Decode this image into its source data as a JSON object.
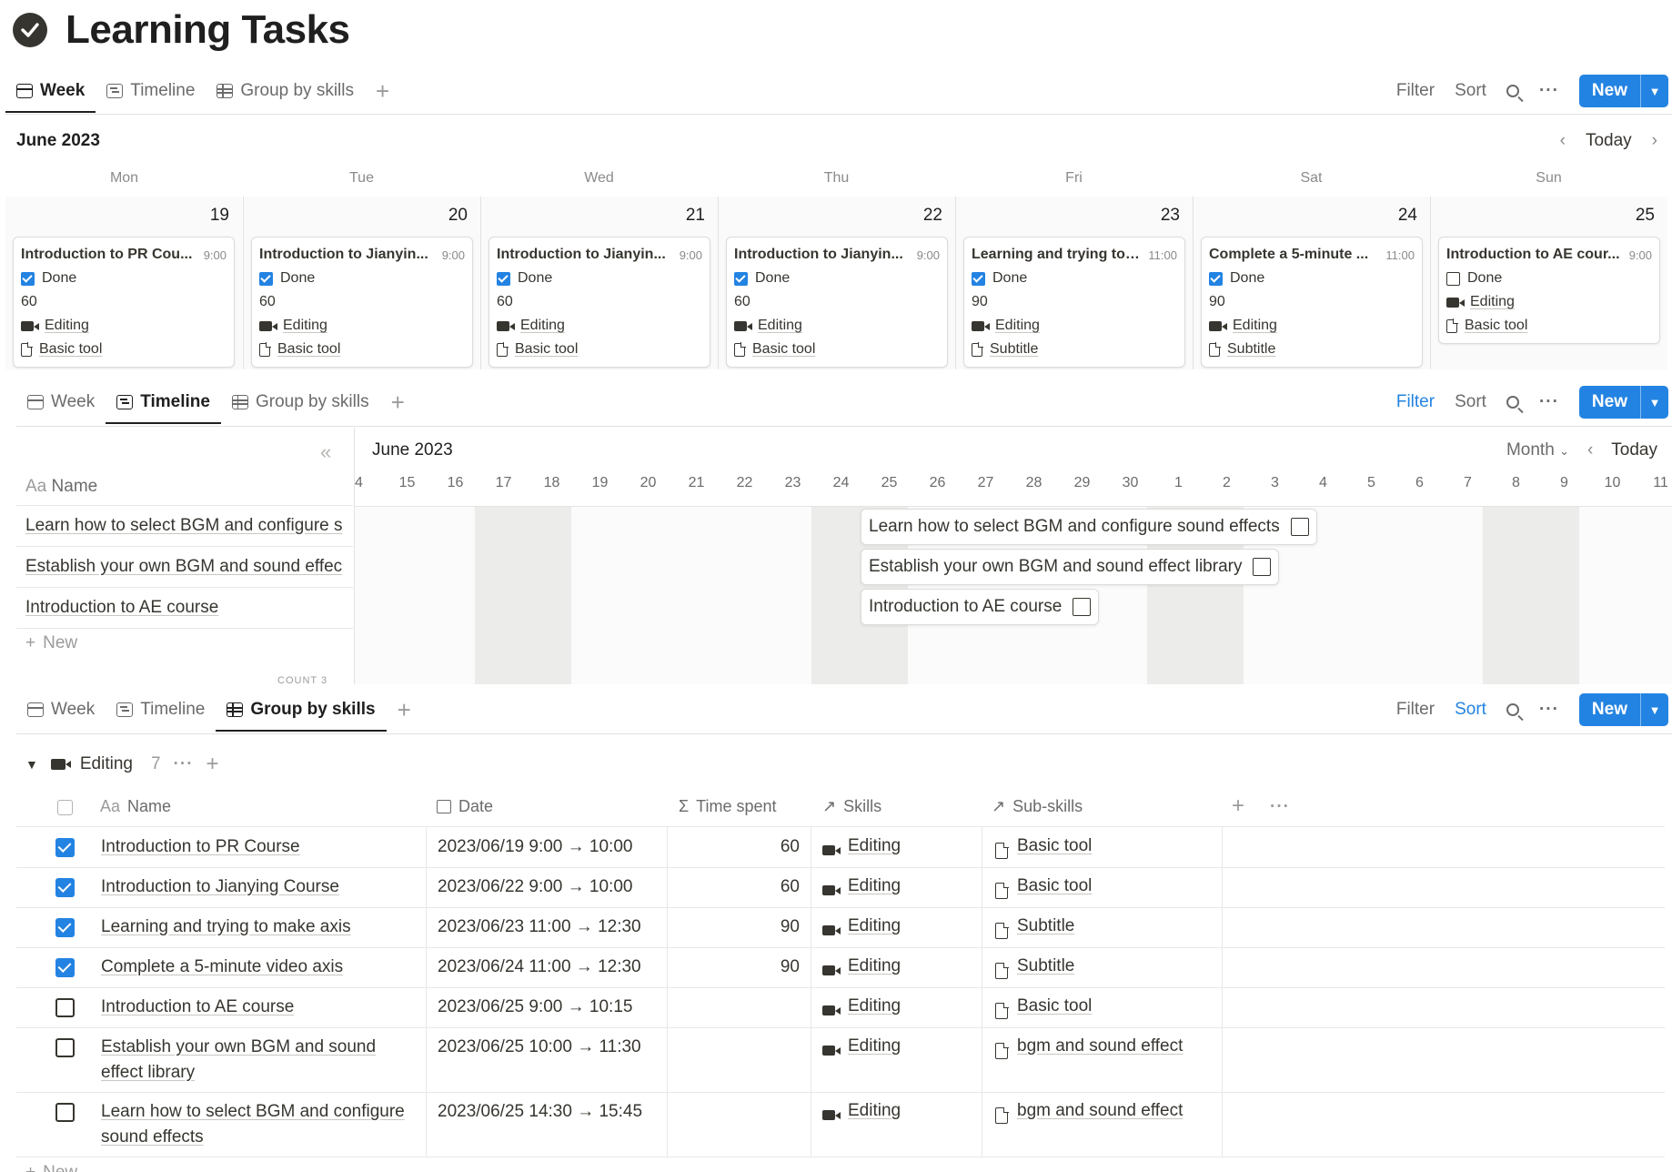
{
  "page": {
    "title": "Learning Tasks"
  },
  "tabs": {
    "week": "Week",
    "timeline": "Timeline",
    "group": "Group by skills"
  },
  "toolbar": {
    "filter": "Filter",
    "sort": "Sort",
    "new": "New"
  },
  "week": {
    "month": "June 2023",
    "today": "Today",
    "days": [
      "Mon",
      "Tue",
      "Wed",
      "Thu",
      "Fri",
      "Sat",
      "Sun"
    ],
    "cards": [
      {
        "num": "19",
        "title": "Introduction to PR Cou...",
        "time": "9:00",
        "done": true,
        "status": "Done",
        "spent": "60",
        "skill": "Editing",
        "sub": "Basic tool"
      },
      {
        "num": "20",
        "title": "Introduction to Jianyin...",
        "time": "9:00",
        "done": true,
        "status": "Done",
        "spent": "60",
        "skill": "Editing",
        "sub": "Basic tool"
      },
      {
        "num": "21",
        "title": "Introduction to Jianyin...",
        "time": "9:00",
        "done": true,
        "status": "Done",
        "spent": "60",
        "skill": "Editing",
        "sub": "Basic tool"
      },
      {
        "num": "22",
        "title": "Introduction to Jianyin...",
        "time": "9:00",
        "done": true,
        "status": "Done",
        "spent": "60",
        "skill": "Editing",
        "sub": "Basic tool"
      },
      {
        "num": "23",
        "title": "Learning and trying to ...",
        "time": "11:00",
        "done": true,
        "status": "Done",
        "spent": "90",
        "skill": "Editing",
        "sub": "Subtitle"
      },
      {
        "num": "24",
        "title": "Complete a 5-minute ...",
        "time": "11:00",
        "done": true,
        "status": "Done",
        "spent": "90",
        "skill": "Editing",
        "sub": "Subtitle"
      },
      {
        "num": "25",
        "title": "Introduction to AE cour...",
        "time": "9:00",
        "done": false,
        "status": "Done",
        "spent": "",
        "skill": "Editing",
        "sub": "Basic tool"
      }
    ]
  },
  "timeline": {
    "month": "June 2023",
    "scale": "Month",
    "today": "Today",
    "name_header": "Name",
    "name_prefix": "Aa",
    "new_label": "New",
    "count_label": "COUNT 3",
    "dates": [
      "4",
      "15",
      "16",
      "17",
      "18",
      "19",
      "20",
      "21",
      "22",
      "23",
      "24",
      "25",
      "26",
      "27",
      "28",
      "29",
      "30",
      "1",
      "2",
      "3",
      "4",
      "5",
      "6",
      "7",
      "8",
      "9",
      "10",
      "11"
    ],
    "rows": [
      "Learn how to select BGM and configure s",
      "Establish your own BGM and sound effec",
      "Introduction to AE course"
    ],
    "bars": [
      "Learn how to select BGM and configure sound effects",
      "Establish your own BGM and sound effect library",
      "Introduction to AE course"
    ]
  },
  "group": {
    "name": "Editing",
    "count": "7",
    "columns": {
      "name_prefix": "Aa",
      "name": "Name",
      "date": "Date",
      "time": "Time spent",
      "skills": "Skills",
      "sub": "Sub-skills"
    },
    "rows": [
      {
        "done": true,
        "name": "Introduction to PR Course",
        "name2": "",
        "date": "2023/06/19 9:00 → 10:00",
        "time": "60",
        "skill": "Editing",
        "sub": "Basic tool"
      },
      {
        "done": true,
        "name": "Introduction to Jianying Course",
        "name2": "",
        "date": "2023/06/22 9:00 → 10:00",
        "time": "60",
        "skill": "Editing",
        "sub": "Basic tool"
      },
      {
        "done": true,
        "name": "Learning and trying to make axis",
        "name2": "",
        "date": "2023/06/23 11:00 → 12:30",
        "time": "90",
        "skill": "Editing",
        "sub": "Subtitle"
      },
      {
        "done": true,
        "name": "Complete a 5-minute video axis",
        "name2": "",
        "date": "2023/06/24 11:00 → 12:30",
        "time": "90",
        "skill": "Editing",
        "sub": "Subtitle"
      },
      {
        "done": false,
        "name": "Introduction to AE course",
        "name2": "",
        "date": "2023/06/25 9:00 → 10:15",
        "time": "",
        "skill": "Editing",
        "sub": "Basic tool"
      },
      {
        "done": false,
        "name": "Establish your own BGM and sound",
        "name2": "effect library",
        "date": "2023/06/25 10:00 → 11:30",
        "time": "",
        "skill": "Editing",
        "sub": "bgm and sound effect"
      },
      {
        "done": false,
        "name": "Learn how to select BGM and configure",
        "name2": "sound effects",
        "date": "2023/06/25 14:30 → 15:45",
        "time": "",
        "skill": "Editing",
        "sub": "bgm and sound effect"
      }
    ],
    "new_label": "New"
  }
}
